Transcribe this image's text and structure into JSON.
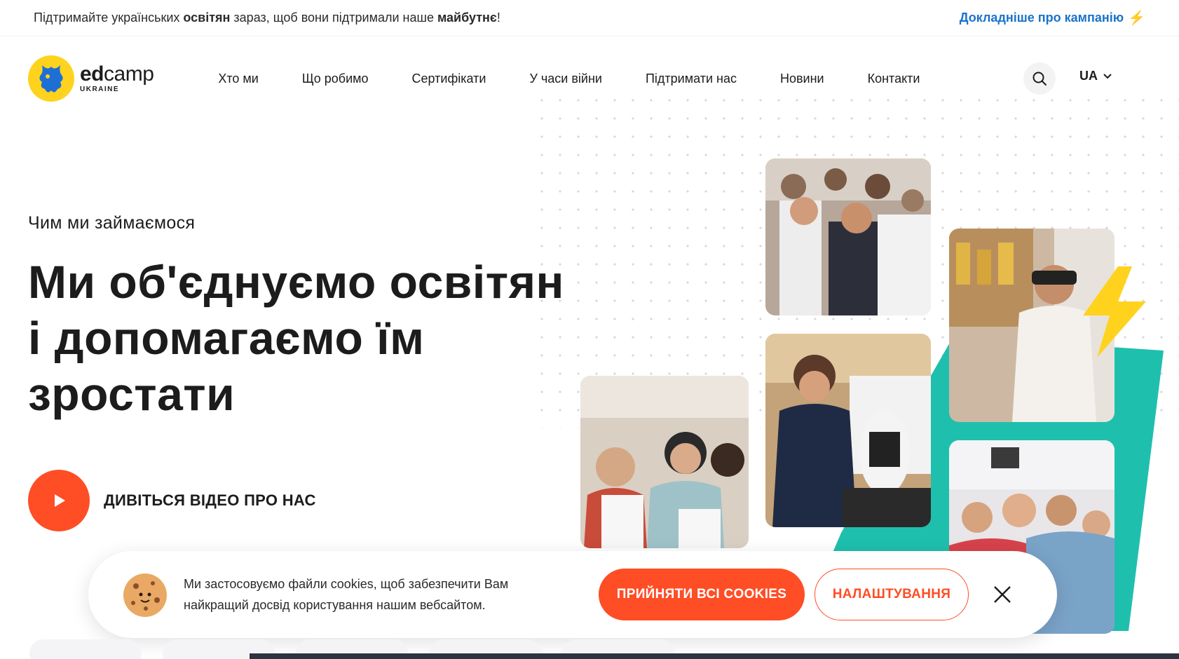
{
  "topbar": {
    "text_part1": "Підтримайте українських ",
    "text_bold1": "освітян",
    "text_part2": " зараз, щоб вони підтримали наше ",
    "text_bold2": "майбутнє",
    "text_part3": "!",
    "link_label": "Докладніше про кампанію",
    "link_icon": "lightning-icon"
  },
  "header": {
    "logo_main_bold": "ed",
    "logo_main_rest": "camp",
    "logo_sub": "UKRAINE",
    "nav": [
      {
        "label": "Хто ми"
      },
      {
        "label": "Що робимо"
      },
      {
        "label": "Сертифікати"
      },
      {
        "label": "У часи війни"
      },
      {
        "label": "Підтримати нас"
      },
      {
        "label": "Новини"
      },
      {
        "label": "Контакти"
      }
    ],
    "search_icon": "search-icon",
    "lang": "UA"
  },
  "hero": {
    "eyebrow": "Чим ми займаємося",
    "title_line1": "Ми об'єднуємо освітян",
    "title_line2": "і допомагаємо їм",
    "title_line3": "зростати",
    "video_label": "ДИВІТЬСЯ ВІДЕО ПРО НАС"
  },
  "cookie": {
    "text": "Ми застосовуємо файли cookies, щоб забезпечити Вам найкращий досвід користування нашим вебсайтом.",
    "accept_label": "ПРИЙНЯТИ ВСІ COOKIES",
    "settings_label": "НАЛАШТУВАННЯ"
  },
  "colors": {
    "accent": "#ff4d25",
    "link": "#1a73c9",
    "brand_yellow": "#ffd21e",
    "teal": "#1fbfae"
  }
}
